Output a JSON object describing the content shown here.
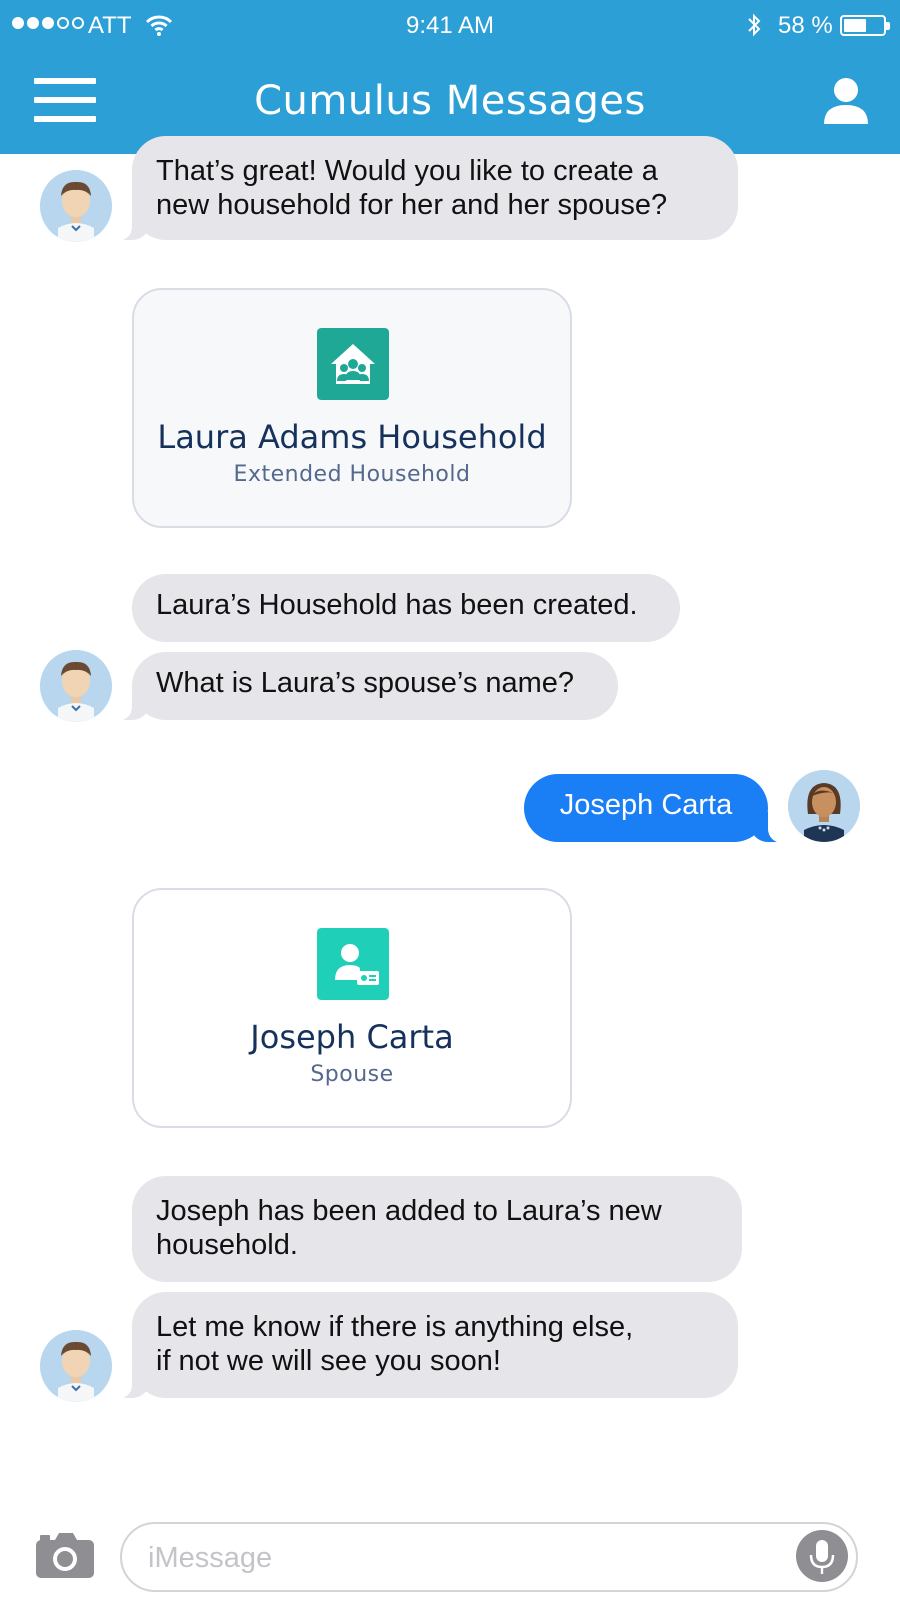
{
  "status_bar": {
    "carrier": "ATT",
    "time": "9:41 AM",
    "battery_percent": "58 %",
    "battery_level": 0.58
  },
  "header": {
    "title": "Cumulus Messages"
  },
  "messages": {
    "bot_1": "That’s great! Would you like to create a\nnew household for her and her spouse?",
    "card_1": {
      "title": "Laura Adams Household",
      "subtitle": "Extended Household",
      "icon": "household-icon",
      "color": "#1fa896"
    },
    "bot_2": "Laura’s Household has been created.",
    "bot_3": "What is Laura’s spouse’s name?",
    "user_1": "Joseph Carta",
    "card_2": {
      "title": "Joseph Carta",
      "subtitle": "Spouse",
      "icon": "contact-icon",
      "color": "#1fcfb8"
    },
    "bot_4": "Joseph has been added to Laura’s new\nhousehold.",
    "bot_5": "Let me know if there is anything else,\nif not we will see you soon!"
  },
  "composer": {
    "placeholder": "iMessage"
  },
  "colors": {
    "header_bg": "#2b9fd6",
    "incoming_bubble": "#e5e5ea",
    "outgoing_bubble": "#1a7ff5"
  }
}
